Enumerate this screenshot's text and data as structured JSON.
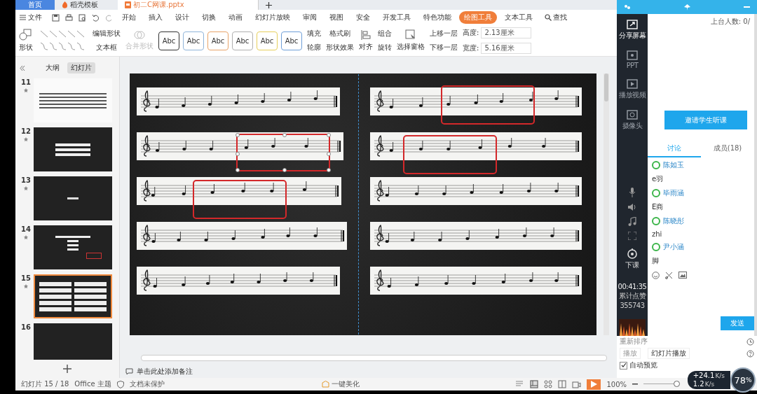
{
  "doc_tabs": [
    {
      "label": "首页",
      "kind": "home",
      "selected": false
    },
    {
      "label": "稻壳模板",
      "kind": "template",
      "selected": false
    },
    {
      "label": "初二C网课.pptx",
      "kind": "doc",
      "selected": true
    }
  ],
  "menu": {
    "file": "文件",
    "tabs": [
      {
        "label": "开始",
        "selected": false
      },
      {
        "label": "插入",
        "selected": false
      },
      {
        "label": "设计",
        "selected": false
      },
      {
        "label": "切换",
        "selected": false
      },
      {
        "label": "动画",
        "selected": false
      },
      {
        "label": "幻灯片放映",
        "selected": false
      },
      {
        "label": "审阅",
        "selected": false
      },
      {
        "label": "视图",
        "selected": false
      },
      {
        "label": "安全",
        "selected": false
      },
      {
        "label": "开发工具",
        "selected": false
      },
      {
        "label": "特色功能",
        "selected": false
      },
      {
        "label": "绘图工具",
        "selected": true
      },
      {
        "label": "文本工具",
        "selected": false
      }
    ],
    "search": "查找"
  },
  "ribbon": {
    "shape": "形状",
    "edit_shape": "编辑形状",
    "textbox": "文本框",
    "merge_shape": {
      "label": "合并形状",
      "disabled": true
    },
    "styles": [
      {
        "label": "Abc",
        "color": "#333333"
      },
      {
        "label": "Abc",
        "color": "#8fb4d9"
      },
      {
        "label": "Abc",
        "color": "#e8a46a"
      },
      {
        "label": "Abc",
        "color": "#b0b0b0"
      },
      {
        "label": "Abc",
        "color": "#e6cf5c"
      },
      {
        "label": "Abc",
        "color": "#6f9fd8"
      }
    ],
    "fill": "填充",
    "format_painter": "格式刷",
    "outline": "轮廓",
    "shape_effects": "形状效果",
    "align": "对齐",
    "group": "组合",
    "rotate": "旋转",
    "selection_pane": "选择窗格",
    "bring_forward": "上移一层",
    "send_backward": "下移一层",
    "height": {
      "label": "高度:",
      "value": "2.13厘米"
    },
    "width": {
      "label": "宽度:",
      "value": "5.16厘米"
    }
  },
  "slides_panel": {
    "tabs": [
      {
        "label": "大纲",
        "selected": false
      },
      {
        "label": "幻灯片",
        "selected": true
      }
    ],
    "thumbnails": [
      {
        "number": "11",
        "kind": "score",
        "selected": false
      },
      {
        "number": "12",
        "kind": "strips",
        "selected": false
      },
      {
        "number": "13",
        "kind": "title",
        "selected": false
      },
      {
        "number": "14",
        "kind": "list",
        "selected": false
      },
      {
        "number": "15",
        "kind": "staffs",
        "selected": true
      },
      {
        "number": "16",
        "kind": "dark",
        "selected": false
      }
    ]
  },
  "notes": {
    "placeholder": "单击此处添加备注"
  },
  "status_bar": {
    "slide": "幻灯片 15 / 18",
    "theme": "Office 主题",
    "protection": "文档未保护",
    "beautify": "一键美化",
    "zoom": "100%",
    "zoom_level": {
      "level": 0.95
    }
  },
  "task_pane": {
    "reorder": "重新排序",
    "play": {
      "label": "播放",
      "disabled": true
    },
    "slideshow": "幻灯片播放",
    "auto_preview": {
      "label": "自动预览",
      "checked": true
    }
  },
  "network": {
    "up": "+24.1",
    "up_unit": "K/s",
    "down": "1.2",
    "down_unit": "K/s",
    "percent": "78",
    "percent_sign": "%"
  },
  "classroom": {
    "online": "上台人数: 0/",
    "sidebar": [
      {
        "label": "分享屏幕",
        "kind": "share",
        "disabled": false
      },
      {
        "label": "PPT",
        "kind": "ppt",
        "disabled": true
      },
      {
        "label": "播放视频",
        "kind": "video",
        "disabled": true
      },
      {
        "label": "摄像头",
        "kind": "camera",
        "disabled": true
      }
    ],
    "end_class": "下课",
    "timer": "00:41:35",
    "likes_label": "累计点赞",
    "likes": "355743",
    "invite": "邀请学生听课",
    "tabs": [
      {
        "label": "讨论",
        "selected": true
      },
      {
        "label": "成员(18)",
        "selected": false
      }
    ],
    "messages": [
      {
        "name": "陈如玉",
        "text": "e羽"
      },
      {
        "name": "毕雨涵",
        "text": "E商"
      },
      {
        "name": "陈晓彤",
        "text": "zhi"
      },
      {
        "name": "尹小涵",
        "text": "脚"
      }
    ],
    "send": "发送"
  }
}
